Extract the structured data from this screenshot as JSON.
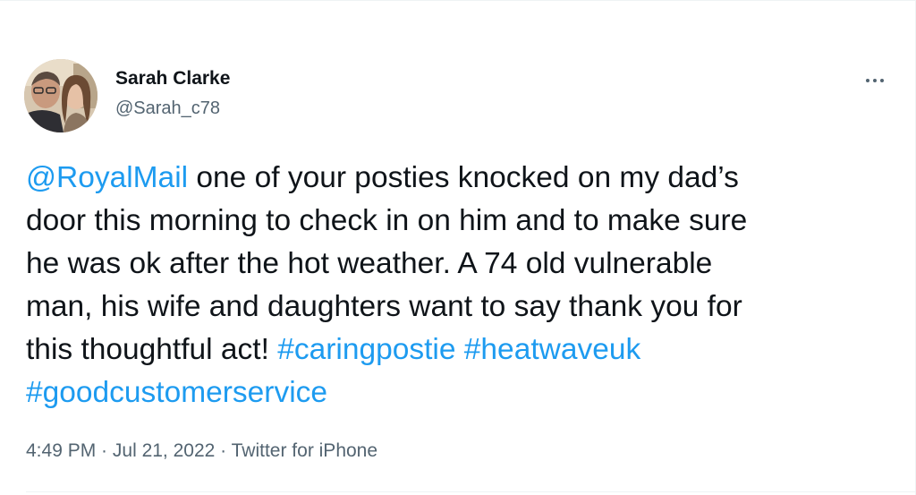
{
  "tweet": {
    "author": {
      "display_name": "Sarah Clarke",
      "handle": "@Sarah_c78"
    },
    "text": {
      "mention": "@RoyalMail",
      "line1_rest": " one of your posties knocked on my dad’s",
      "line2": "door this morning to check in on him and to make sure",
      "line3": "he was ok after the hot weather. A 74 old vulnerable",
      "line4": "man, his wife and daughters want to say thank you for",
      "line5_start": "this thoughtful act! ",
      "hashtag1": "#caringpostie",
      "hashtag2": "#heatwaveuk",
      "hashtag3": "#goodcustomerservice"
    },
    "meta": {
      "time": "4:49 PM",
      "sep1": " · ",
      "date": "Jul 21, 2022",
      "sep2": " · ",
      "source": "Twitter for iPhone"
    }
  },
  "icons": {
    "more": "more-horizontal-icon"
  },
  "colors": {
    "link": "#1d9bf0",
    "text": "#0f1419",
    "secondary": "#536471"
  }
}
